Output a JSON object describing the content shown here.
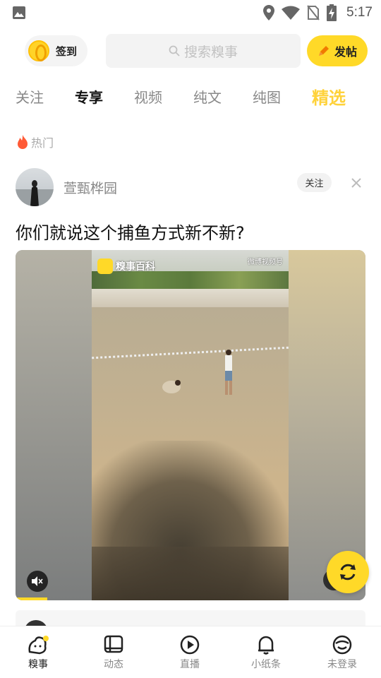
{
  "status_bar": {
    "time": "5:17",
    "icons": [
      "image-icon",
      "location-icon",
      "wifi-icon",
      "no-sim-icon",
      "battery-charging-icon"
    ]
  },
  "header": {
    "checkin_label": "签到",
    "search_placeholder": "搜索糗事",
    "post_label": "发帖"
  },
  "tabs": [
    {
      "label": "关注"
    },
    {
      "label": "专享"
    },
    {
      "label": "视频"
    },
    {
      "label": "纯文"
    },
    {
      "label": "纯图"
    },
    {
      "label": "精选"
    }
  ],
  "active_tab": "专享",
  "hot_label": "热门",
  "post": {
    "username": "萱甄桦园",
    "follow_label": "关注",
    "title": "你们就说这个捕鱼方式新不新?",
    "video_watermark": "糗事百科",
    "video_watermark_right": "微博视频号",
    "muted": true,
    "progress_fraction": 0.09
  },
  "bottom_nav": [
    {
      "label": "糗事",
      "icon": "qiushi-icon"
    },
    {
      "label": "动态",
      "icon": "dynamic-icon"
    },
    {
      "label": "直播",
      "icon": "play-icon"
    },
    {
      "label": "小纸条",
      "icon": "bell-icon"
    },
    {
      "label": "未登录",
      "icon": "profile-icon"
    }
  ],
  "colors": {
    "accent": "#ffd928",
    "featured_tab": "#ffd23a",
    "muted_text": "#888888"
  }
}
